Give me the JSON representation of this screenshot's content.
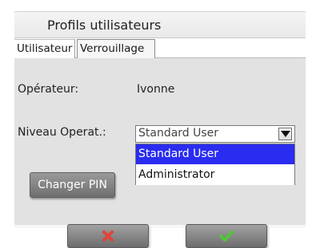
{
  "header": {
    "title": "Profils utilisateurs"
  },
  "tabs": [
    {
      "label": "Utilisateur",
      "active": true
    },
    {
      "label": "Verrouillage",
      "active": false
    }
  ],
  "form": {
    "operator_label": "Opérateur:",
    "operator_value": "Ivonne",
    "level_label": "Niveau Operat.:",
    "level_selected": "Standard User",
    "level_options": [
      "Standard User",
      "Administrator"
    ]
  },
  "buttons": {
    "change_pin": "Changer PIN",
    "cancel_icon": "red-x-icon",
    "confirm_icon": "green-check-icon"
  },
  "colors": {
    "highlight": "#2a2cf0",
    "panel": "#e2e2e2",
    "cancel": "#e0443a",
    "confirm": "#4fc63a"
  }
}
